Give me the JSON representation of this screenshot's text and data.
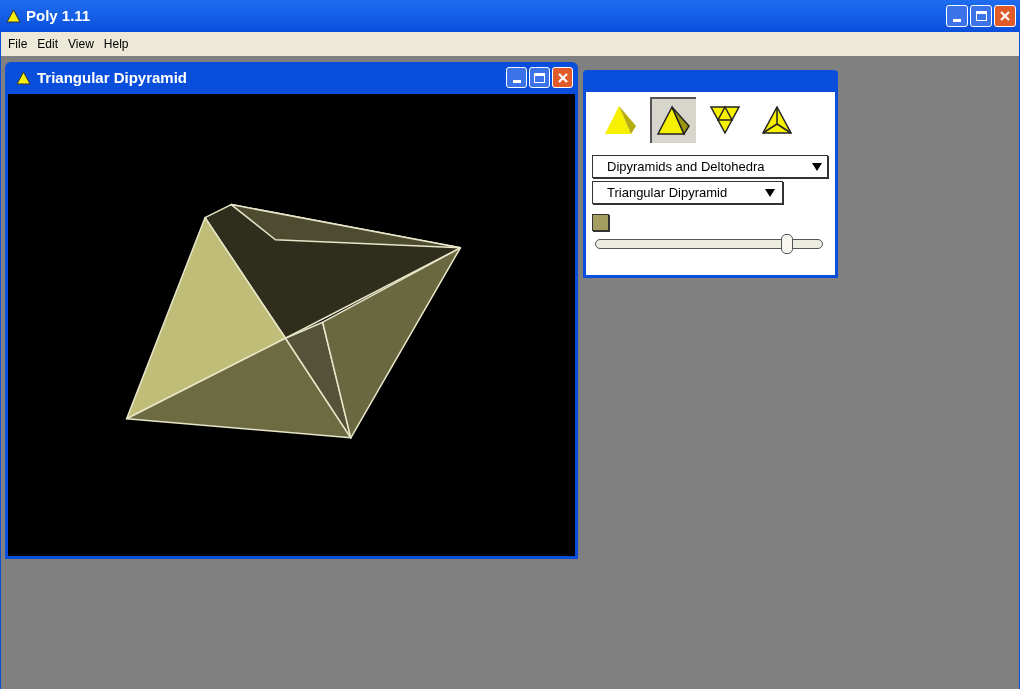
{
  "app": {
    "title": "Poly 1.11"
  },
  "menu": [
    "File",
    "Edit",
    "View",
    "Help"
  ],
  "viewer": {
    "title": "Triangular Dipyramid"
  },
  "palette": {
    "tools": [
      {
        "kind": "solid",
        "selected": false
      },
      {
        "kind": "outline",
        "selected": true
      },
      {
        "kind": "net",
        "selected": false
      },
      {
        "kind": "vertex",
        "selected": false
      }
    ],
    "family": "Dipyramids and Deltohedra",
    "shape": "Triangular Dipyramid",
    "slider": {
      "level": 0.84
    }
  }
}
